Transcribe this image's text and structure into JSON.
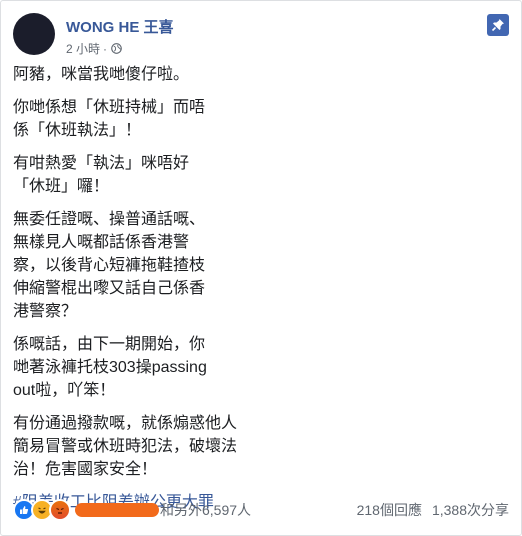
{
  "post": {
    "author": "WONG HE 王喜",
    "time": "2 小時",
    "dot": "·",
    "paragraphs": [
      "阿豬，咪當我哋傻仔啦。",
      "你哋係想「休班持械」而唔\n係「休班執法」！",
      "有咁熱愛「執法」咪唔好\n「休班」囉！",
      "無委任證嘅、操普通話嘅、\n無樣見人嘅都話係香港警\n察，以後背心短褲拖鞋揸枝\n伸縮警棍出嚟又話自己係香\n港警察？",
      "係嘅話，由下一期開始，你\n哋著泳褲托枝303操passing\nout啦，吖笨！",
      "有份通過撥款嘅，就係煽惑他人\n簡易冒警或休班時犯法，破壞法\n治！危害國家安全！"
    ],
    "hashtag": "#阻差收工比阻差辦公更大罪"
  },
  "footer": {
    "reaction_icons": [
      "like-icon",
      "haha-icon",
      "angry-icon"
    ],
    "reactions_text": "和另外6,597人",
    "comments": "218個回應",
    "shares": "1,388次分享"
  },
  "colors": {
    "link": "#385898",
    "pin": "#4267b2",
    "redaction": "#f26a1b"
  }
}
